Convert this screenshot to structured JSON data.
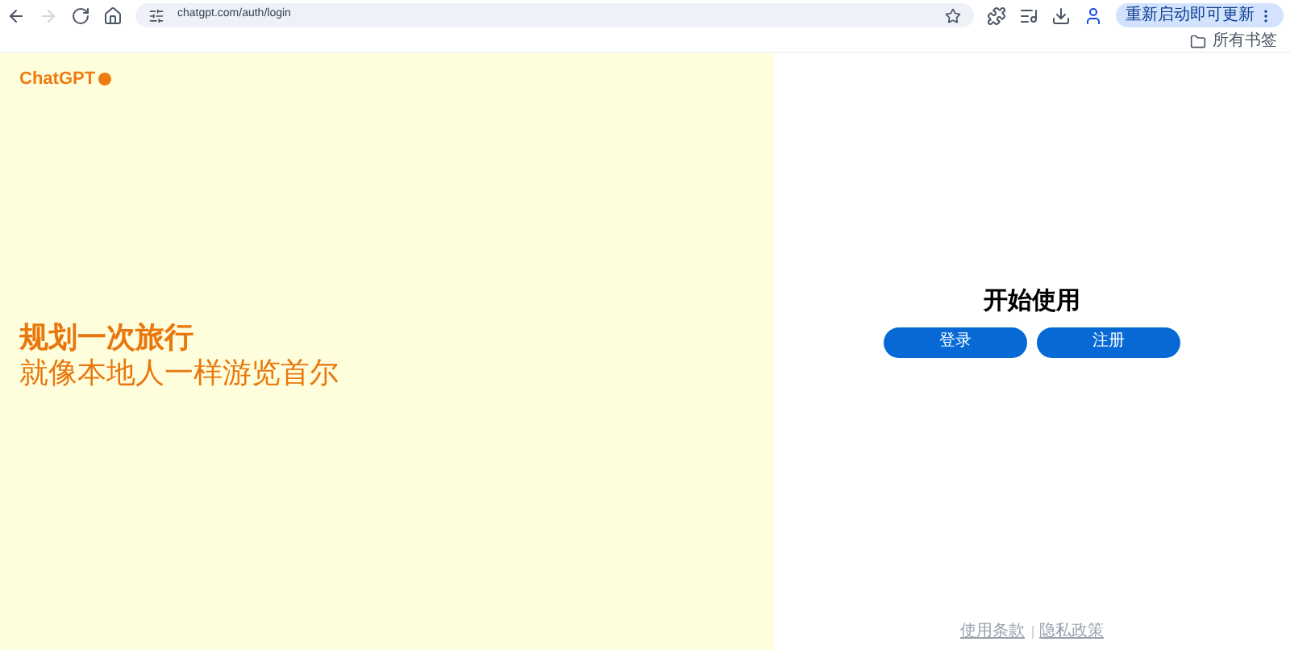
{
  "browser": {
    "url": "chatgpt.com/auth/login",
    "update_button": "重新启动即可更新",
    "bookmarks": "所有书签"
  },
  "brand": {
    "name": "ChatGPT"
  },
  "hero": {
    "title": "规划一次旅行",
    "subtitle": "就像本地人一样游览首尔"
  },
  "auth": {
    "heading": "开始使用",
    "buttons": [
      "登录",
      "注册"
    ]
  },
  "footer": {
    "links": [
      "使用条款",
      "隐私政策"
    ]
  }
}
